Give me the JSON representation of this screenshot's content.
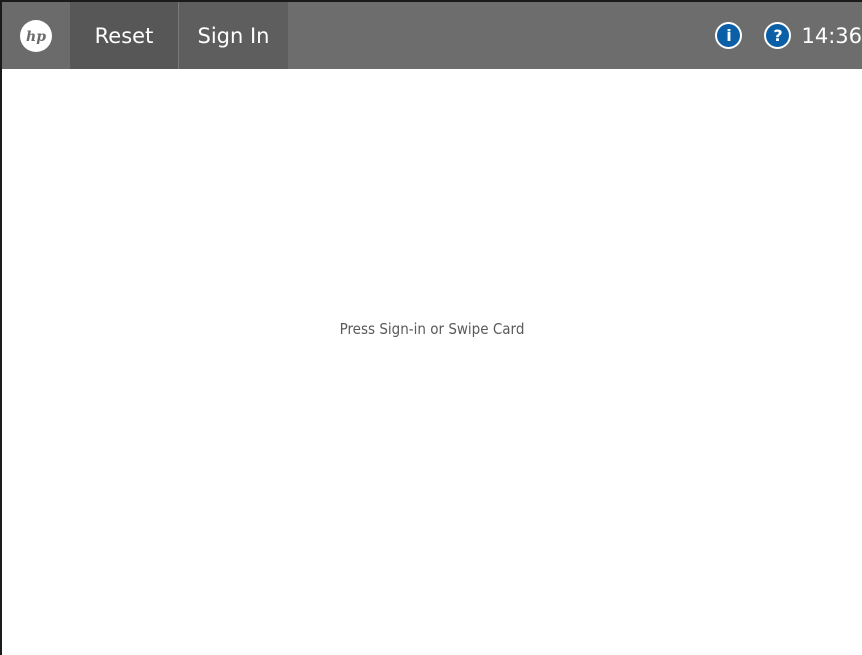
{
  "header": {
    "logo_text": "hp",
    "reset_label": "Reset",
    "signin_label": "Sign In",
    "info_icon_glyph": "i",
    "help_icon_glyph": "?",
    "clock": "14:36"
  },
  "main": {
    "message": "Press Sign-in or Swipe Card"
  },
  "colors": {
    "header_bg": "#6d6d6d",
    "accent_icon": "#0b5fa6"
  }
}
